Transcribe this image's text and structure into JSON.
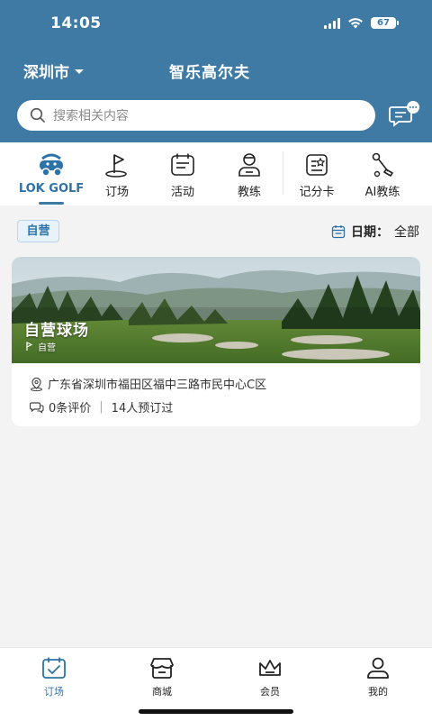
{
  "status": {
    "time": "14:05",
    "battery": "67"
  },
  "header": {
    "city": "深圳市",
    "title": "智乐高尔夫"
  },
  "search": {
    "placeholder": "搜索相关内容"
  },
  "tabs": [
    {
      "label": "LOK GOLF",
      "icon": "golf-cart-icon",
      "active": true
    },
    {
      "label": "订场",
      "icon": "golf-flag-icon"
    },
    {
      "label": "活动",
      "icon": "calendar-list-icon"
    },
    {
      "label": "教练",
      "icon": "coach-icon"
    },
    {
      "label": "记分卡",
      "icon": "scorecard-icon"
    },
    {
      "label": "AI教练",
      "icon": "golf-club-icon"
    }
  ],
  "filter": {
    "badge": "自营",
    "date_label": "日期：",
    "date_value": "全部"
  },
  "course": {
    "title": "自营球场",
    "tag": "自营",
    "address": "广东省深圳市福田区福中三路市民中心C区",
    "reviews": "0条评价",
    "bookings": "14人预订过"
  },
  "bottom_nav": [
    {
      "label": "订场",
      "icon": "calendar-check-icon",
      "active": true
    },
    {
      "label": "商城",
      "icon": "store-icon"
    },
    {
      "label": "会员",
      "icon": "crown-icon"
    },
    {
      "label": "我的",
      "icon": "user-icon"
    }
  ],
  "colors": {
    "primary": "#3f7aa5",
    "accent_text": "#2d73a8"
  }
}
